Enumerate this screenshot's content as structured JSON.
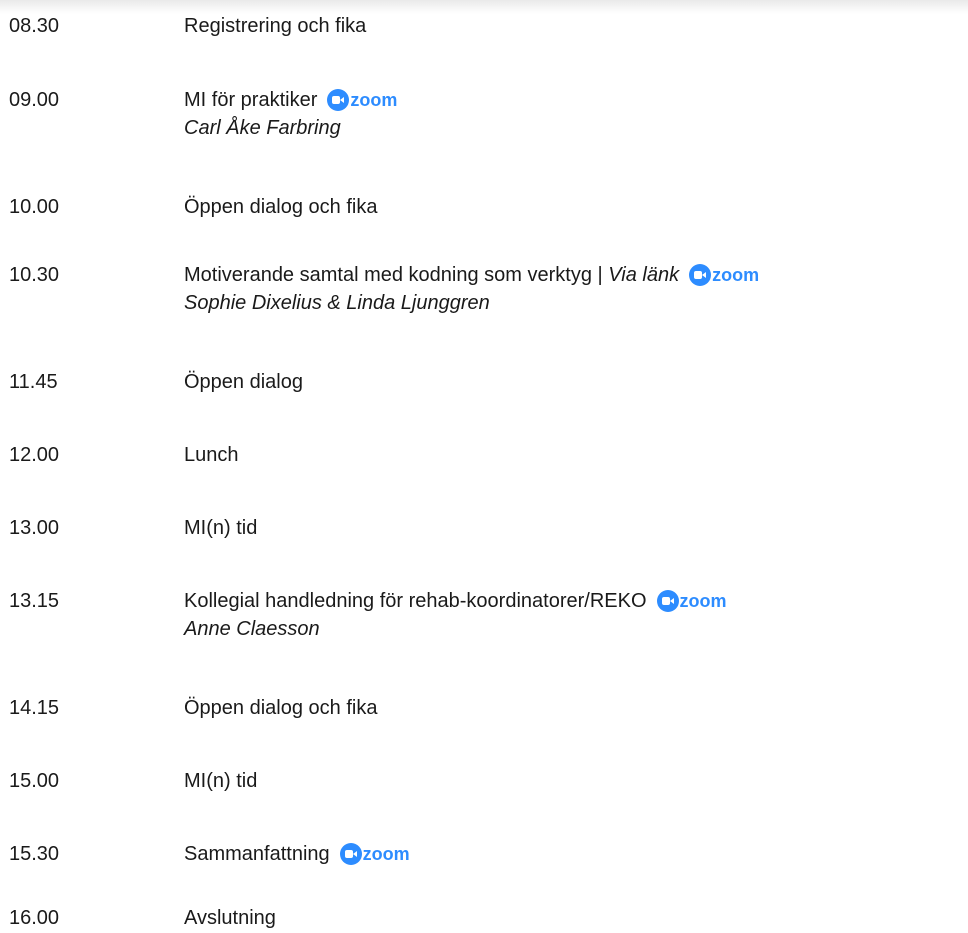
{
  "zoom": {
    "word": "zoom",
    "brand_color": "#2d8cff",
    "icon": "zoom-camera-icon"
  },
  "schedule": [
    {
      "time": "08.30",
      "title": "Registrering och fika"
    },
    {
      "time": "09.00",
      "title": "MI för praktiker",
      "zoom": true,
      "speaker": "Carl Åke Farbring"
    },
    {
      "time": "10.00",
      "title": "Öppen dialog och fika"
    },
    {
      "time": "10.30",
      "title": "Motiverande samtal med kodning som verktyg | ",
      "title_italic": "Via länk",
      "zoom": true,
      "speaker": "Sophie Dixelius & Linda Ljunggren"
    },
    {
      "time": "11.45",
      "title": "Öppen dialog"
    },
    {
      "time": "12.00",
      "title": "Lunch"
    },
    {
      "time": "13.00",
      "title": "MI(n) tid"
    },
    {
      "time": "13.15",
      "title": "Kollegial handledning för rehab-koordinatorer/REKO",
      "zoom": true,
      "speaker": "Anne Claesson"
    },
    {
      "time": "14.15",
      "title": "Öppen dialog och fika"
    },
    {
      "time": "15.00",
      "title": "MI(n) tid"
    },
    {
      "time": "15.30",
      "title": "Sammanfattning",
      "zoom": true
    },
    {
      "time": "16.00",
      "title": "Avslutning"
    }
  ]
}
